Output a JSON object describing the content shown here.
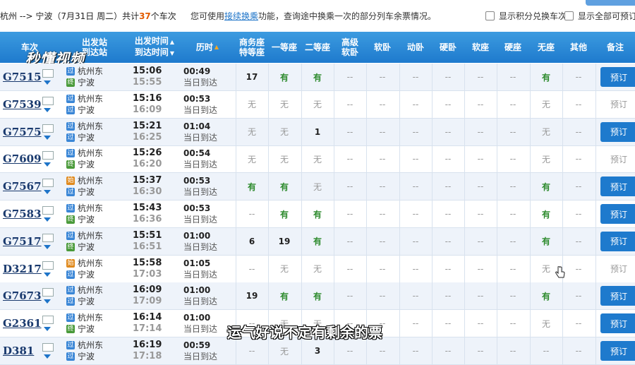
{
  "topbar": {
    "route_prefix": "杭州 --> 宁波（7月31日  周二）共计",
    "count": "37",
    "route_suffix": "个车次",
    "tip_prefix": "您可使用",
    "tip_link": "接续换乘",
    "tip_suffix": "功能，查询途中换乘一次的部分列车余票情况。",
    "check_points": "显示积分兑换车次",
    "check_all": "显示全部可预订"
  },
  "header": {
    "train_no": "车次",
    "stations": [
      "出发站",
      "到达站"
    ],
    "times": [
      "出发时间",
      "到达时间"
    ],
    "duration": "历时",
    "seat_cols": [
      "商务座\n特等座",
      "一等座",
      "二等座",
      "高级\n软卧",
      "软卧",
      "动卧",
      "硬卧",
      "软座",
      "硬座",
      "无座",
      "其他"
    ],
    "remark": "备注",
    "sort_up": "▲",
    "sort_dn": "▼"
  },
  "logo_text": "秒懂视频",
  "subtitle": "运气好说不定有剩余的票",
  "book_label": "预订",
  "rows": [
    {
      "no": "G7515",
      "from": "杭州东",
      "to": "宁波",
      "from_tag": "过",
      "to_tag": "终",
      "dep": "15:06",
      "arr": "15:55",
      "dur": "00:49",
      "arrive": "当日到达",
      "seats": [
        "17",
        "有",
        "有",
        "--",
        "--",
        "--",
        "--",
        "--",
        "--",
        "有",
        "--"
      ],
      "bookable": true
    },
    {
      "no": "G7539",
      "from": "杭州东",
      "to": "宁波",
      "from_tag": "过",
      "to_tag": "过",
      "dep": "15:16",
      "arr": "16:09",
      "dur": "00:53",
      "arrive": "当日到达",
      "seats": [
        "无",
        "无",
        "无",
        "--",
        "--",
        "--",
        "--",
        "--",
        "--",
        "无",
        "--"
      ],
      "bookable": false
    },
    {
      "no": "G7575",
      "from": "杭州东",
      "to": "宁波",
      "from_tag": "过",
      "to_tag": "过",
      "dep": "15:21",
      "arr": "16:25",
      "dur": "01:04",
      "arrive": "当日到达",
      "seats": [
        "无",
        "无",
        "1",
        "--",
        "--",
        "--",
        "--",
        "--",
        "--",
        "无",
        "--"
      ],
      "bookable": true
    },
    {
      "no": "G7609",
      "from": "杭州东",
      "to": "宁波",
      "from_tag": "过",
      "to_tag": "终",
      "dep": "15:26",
      "arr": "16:20",
      "dur": "00:54",
      "arrive": "当日到达",
      "seats": [
        "无",
        "无",
        "无",
        "--",
        "--",
        "--",
        "--",
        "--",
        "--",
        "无",
        "--"
      ],
      "bookable": false
    },
    {
      "no": "G7567",
      "from": "杭州东",
      "to": "宁波",
      "from_tag": "始",
      "to_tag": "过",
      "dep": "15:37",
      "arr": "16:30",
      "dur": "00:53",
      "arrive": "当日到达",
      "seats": [
        "有",
        "有",
        "无",
        "--",
        "--",
        "--",
        "--",
        "--",
        "--",
        "有",
        "--"
      ],
      "bookable": true
    },
    {
      "no": "G7583",
      "from": "杭州东",
      "to": "宁波",
      "from_tag": "过",
      "to_tag": "终",
      "dep": "15:43",
      "arr": "16:36",
      "dur": "00:53",
      "arrive": "当日到达",
      "seats": [
        "--",
        "有",
        "有",
        "--",
        "--",
        "--",
        "--",
        "--",
        "--",
        "有",
        "--"
      ],
      "bookable": true
    },
    {
      "no": "G7517",
      "from": "杭州东",
      "to": "宁波",
      "from_tag": "过",
      "to_tag": "终",
      "dep": "15:51",
      "arr": "16:51",
      "dur": "01:00",
      "arrive": "当日到达",
      "seats": [
        "6",
        "19",
        "有",
        "--",
        "--",
        "--",
        "--",
        "--",
        "--",
        "有",
        "--"
      ],
      "bookable": true
    },
    {
      "no": "D3217",
      "from": "杭州东",
      "to": "宁波",
      "from_tag": "始",
      "to_tag": "过",
      "dep": "15:58",
      "arr": "17:03",
      "dur": "01:05",
      "arrive": "当日到达",
      "seats": [
        "--",
        "无",
        "无",
        "--",
        "--",
        "--",
        "--",
        "--",
        "--",
        "无",
        "--"
      ],
      "bookable": false
    },
    {
      "no": "G7673",
      "from": "杭州东",
      "to": "宁波",
      "from_tag": "过",
      "to_tag": "过",
      "dep": "16:09",
      "arr": "17:09",
      "dur": "01:00",
      "arrive": "当日到达",
      "seats": [
        "19",
        "有",
        "有",
        "--",
        "--",
        "--",
        "--",
        "--",
        "--",
        "有",
        "--"
      ],
      "bookable": true
    },
    {
      "no": "G2361",
      "from": "杭州东",
      "to": "宁波",
      "from_tag": "过",
      "to_tag": "终",
      "dep": "16:14",
      "arr": "17:14",
      "dur": "01:00",
      "arrive": "当日到达",
      "seats": [
        "--",
        "无",
        "无",
        "--",
        "--",
        "--",
        "--",
        "--",
        "--",
        "无",
        "--"
      ],
      "bookable": true
    },
    {
      "no": "D381",
      "from": "杭州东",
      "to": "宁波",
      "from_tag": "过",
      "to_tag": "过",
      "dep": "16:19",
      "arr": "17:18",
      "dur": "00:59",
      "arrive": "当日到达",
      "seats": [
        "--",
        "无",
        "3",
        "--",
        "--",
        "--",
        "--",
        "--",
        "--",
        "--",
        "--"
      ],
      "bookable": true
    }
  ]
}
